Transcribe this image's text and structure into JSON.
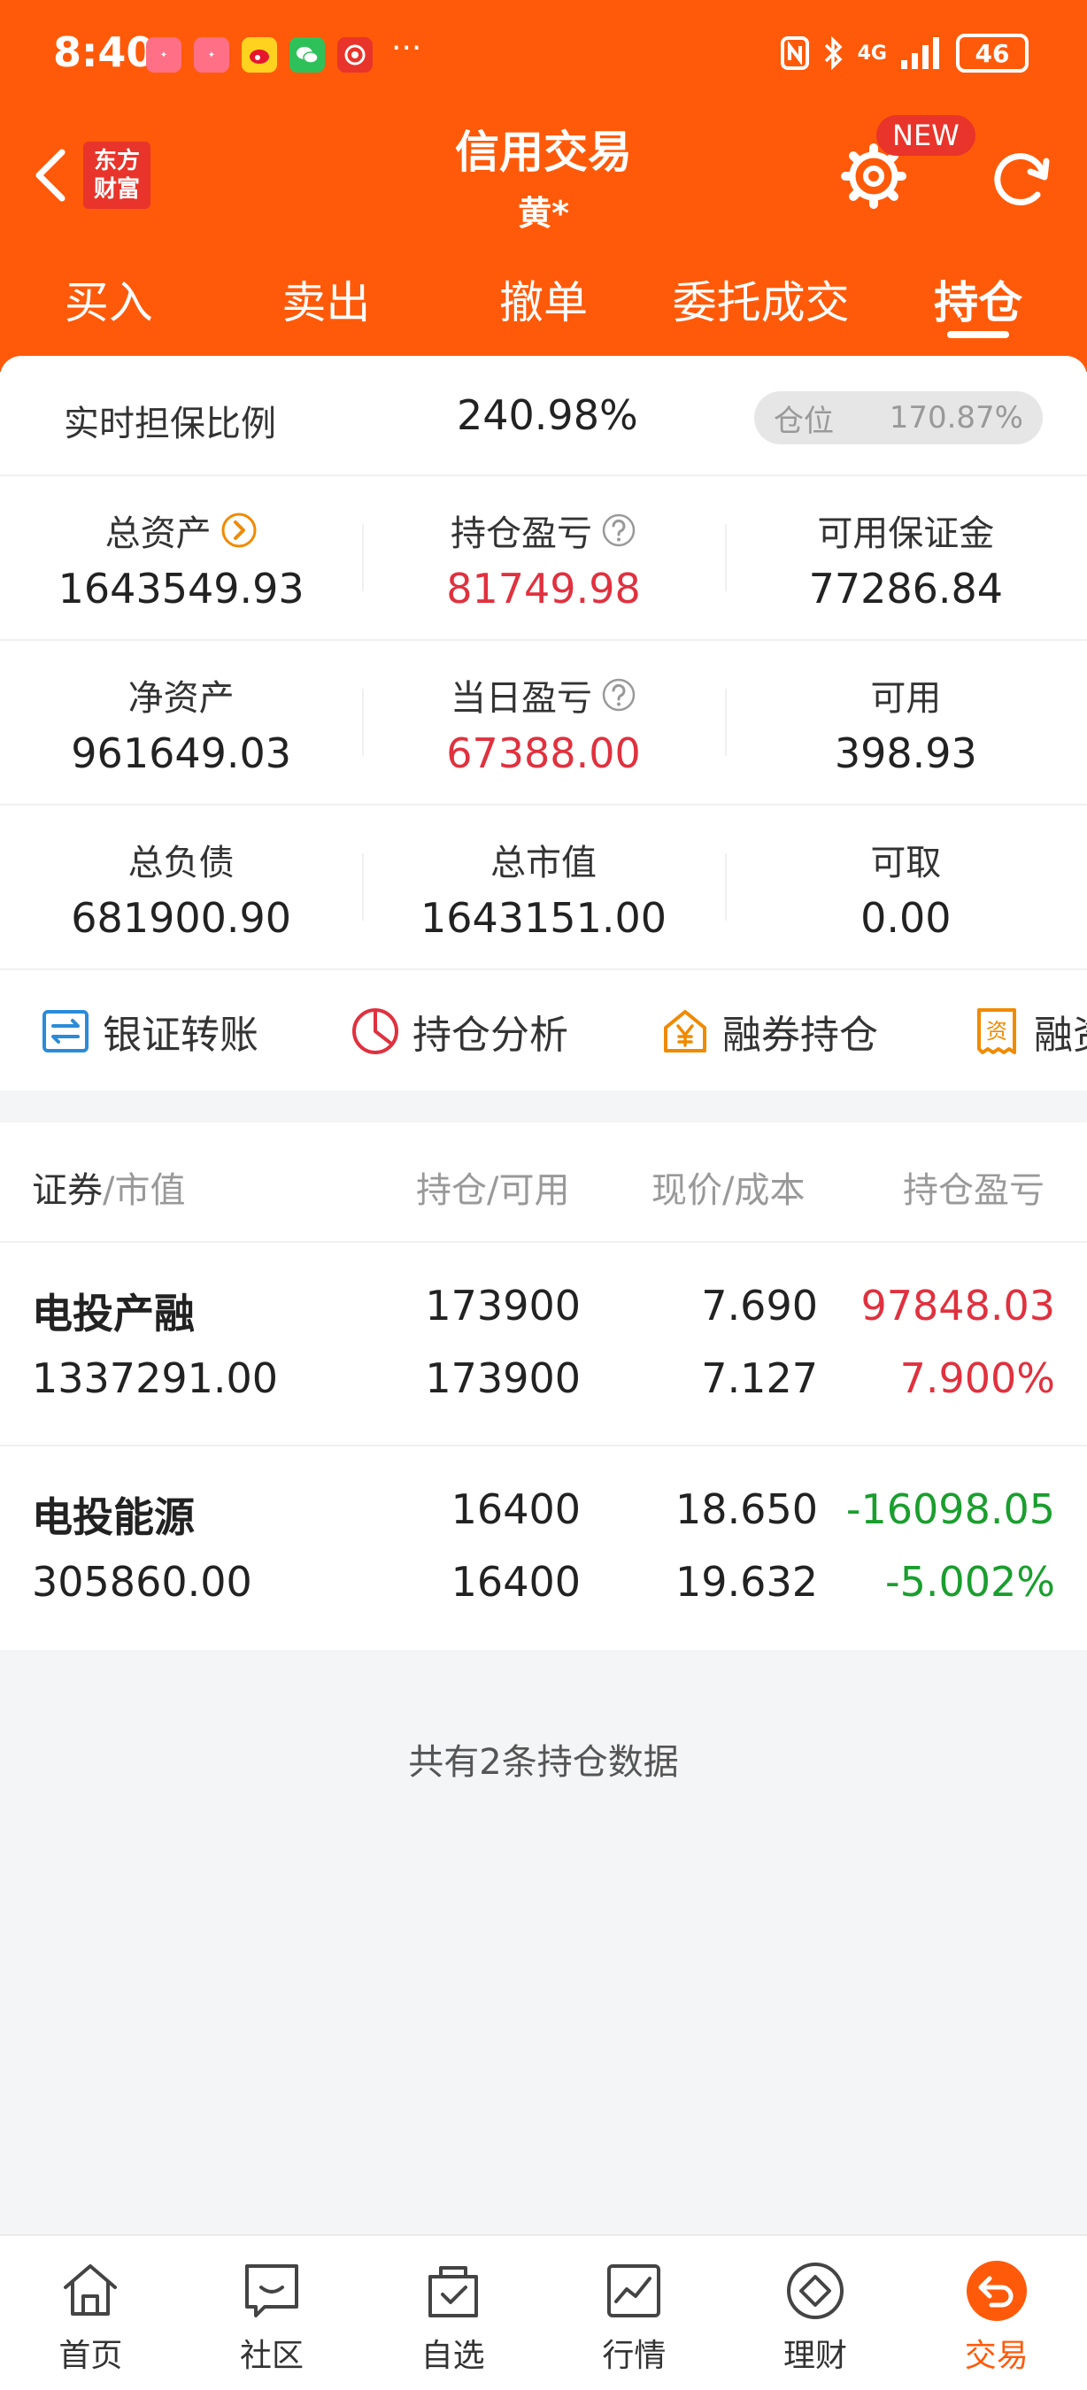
{
  "status_bar": {
    "time": "8:40",
    "more": "···",
    "network": "4G",
    "battery": "46"
  },
  "header": {
    "logo_text": "东方财富",
    "title": "信用交易",
    "subtitle": "黄*",
    "new_badge": "NEW"
  },
  "tabs": [
    {
      "label": "买入",
      "active": false
    },
    {
      "label": "卖出",
      "active": false
    },
    {
      "label": "撤单",
      "active": false
    },
    {
      "label": "委托成交",
      "active": false
    },
    {
      "label": "持仓",
      "active": true
    }
  ],
  "summary": {
    "ratio_label": "实时担保比例",
    "ratio_value": "240.98%",
    "position_label": "仓位",
    "position_value": "170.87%",
    "rows": [
      [
        {
          "label": "总资产",
          "value": "1643549.93",
          "icon": "arrow-right-circle-icon",
          "color": "#222222"
        },
        {
          "label": "持仓盈亏",
          "value": "81749.98",
          "icon": "question-circle-icon",
          "color": "#e0313f"
        },
        {
          "label": "可用保证金",
          "value": "77286.84",
          "icon": "",
          "color": "#222222"
        }
      ],
      [
        {
          "label": "净资产",
          "value": "961649.03",
          "icon": "",
          "color": "#222222"
        },
        {
          "label": "当日盈亏",
          "value": "67388.00",
          "icon": "question-circle-icon",
          "color": "#e0313f"
        },
        {
          "label": "可用",
          "value": "398.93",
          "icon": "",
          "color": "#222222"
        }
      ],
      [
        {
          "label": "总负债",
          "value": "681900.90",
          "icon": "",
          "color": "#222222"
        },
        {
          "label": "总市值",
          "value": "1643151.00",
          "icon": "",
          "color": "#222222"
        },
        {
          "label": "可取",
          "value": "0.00",
          "icon": "",
          "color": "#222222"
        }
      ]
    ]
  },
  "quick_actions": [
    {
      "label": "银证转账",
      "icon": "transfer-icon"
    },
    {
      "label": "持仓分析",
      "icon": "pie-chart-icon"
    },
    {
      "label": "融券持仓",
      "icon": "yen-house-icon"
    },
    {
      "label": "融资",
      "icon": "receipt-icon"
    }
  ],
  "table": {
    "headers": {
      "security": "证券",
      "market_value": "/市值",
      "position": "持仓/可用",
      "price": "现价/成本",
      "pnl": "持仓盈亏"
    },
    "rows": [
      {
        "name": "电投产融",
        "market_value": "1337291.00",
        "position": "173900",
        "available": "173900",
        "price": "7.690",
        "cost": "7.127",
        "pnl": "97848.03",
        "pnl_pct": "7.900%",
        "trend": "up"
      },
      {
        "name": "电投能源",
        "market_value": "305860.00",
        "position": "16400",
        "available": "16400",
        "price": "18.650",
        "cost": "19.632",
        "pnl": "-16098.05",
        "pnl_pct": "-5.002%",
        "trend": "down"
      }
    ]
  },
  "footer_note": "共有2条持仓数据",
  "bottom_nav": [
    {
      "label": "首页",
      "icon": "home-icon",
      "active": false
    },
    {
      "label": "社区",
      "icon": "chat-icon",
      "active": false
    },
    {
      "label": "自选",
      "icon": "checked-bag-icon",
      "active": false
    },
    {
      "label": "行情",
      "icon": "line-chart-icon",
      "active": false
    },
    {
      "label": "理财",
      "icon": "diamond-icon",
      "active": false
    },
    {
      "label": "交易",
      "icon": "trade-icon",
      "active": true
    }
  ],
  "colors": {
    "brand": "#ff5a0a",
    "up": "#e0313f",
    "down": "#1a9e2e"
  }
}
